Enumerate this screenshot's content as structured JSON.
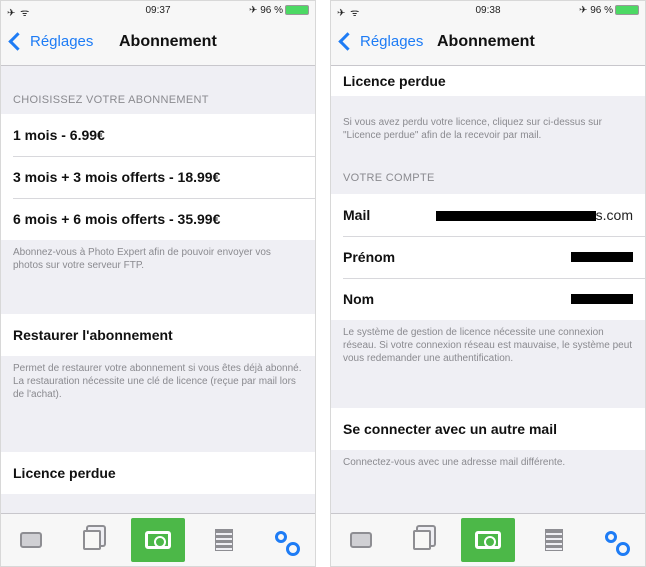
{
  "left": {
    "status": {
      "signal": "✈ ᯤ",
      "time": "09:37",
      "battery": "✈ 96 %"
    },
    "nav": {
      "back": "Réglages",
      "title": "Abonnement"
    },
    "choose_header": "CHOISISSEZ VOTRE ABONNEMENT",
    "plans": [
      "1 mois - 6.99€",
      "3 mois + 3 mois offerts - 18.99€",
      "6 mois + 6 mois offerts - 35.99€"
    ],
    "plans_footer": "Abonnez-vous à Photo Expert afin de pouvoir envoyer vos photos sur votre serveur FTP.",
    "restore": "Restaurer l'abonnement",
    "restore_footer": "Permet de restaurer votre abonnement si vous êtes déjà abonné. La restauration nécessite une clé de licence (reçue par mail lors de l'achat).",
    "lost": "Licence perdue"
  },
  "right": {
    "status": {
      "signal": "✈ ᯤ",
      "time": "09:38",
      "battery": "✈ 96 %"
    },
    "nav": {
      "back": "Réglages",
      "title": "Abonnement"
    },
    "lost": "Licence perdue",
    "lost_footer": "Si vous avez perdu votre licence, cliquez sur ci-dessus sur \"Licence perdue\" afin de la recevoir par mail.",
    "account_header": "VOTRE COMPTE",
    "mail_label": "Mail",
    "mail_value_suffix": "s.com",
    "first_name_label": "Prénom",
    "last_name_label": "Nom",
    "account_footer": "Le système de gestion de licence nécessite une connexion réseau. Si votre connexion réseau est mauvaise, le système peut vous redemander une authentification.",
    "other_mail": "Se connecter avec un autre mail",
    "other_mail_footer": "Connectez-vous avec une adresse mail différente."
  },
  "tabs": [
    {
      "icon": "tray-icon"
    },
    {
      "icon": "documents-icon"
    },
    {
      "icon": "camera-icon",
      "active_color": "#4cb848"
    },
    {
      "icon": "list-icon"
    },
    {
      "icon": "settings-gear-icon",
      "active_color": "#1e7cf5"
    }
  ],
  "colors": {
    "accent": "#1e7cf5",
    "camera": "#4cb848",
    "background": "#efeff4"
  }
}
